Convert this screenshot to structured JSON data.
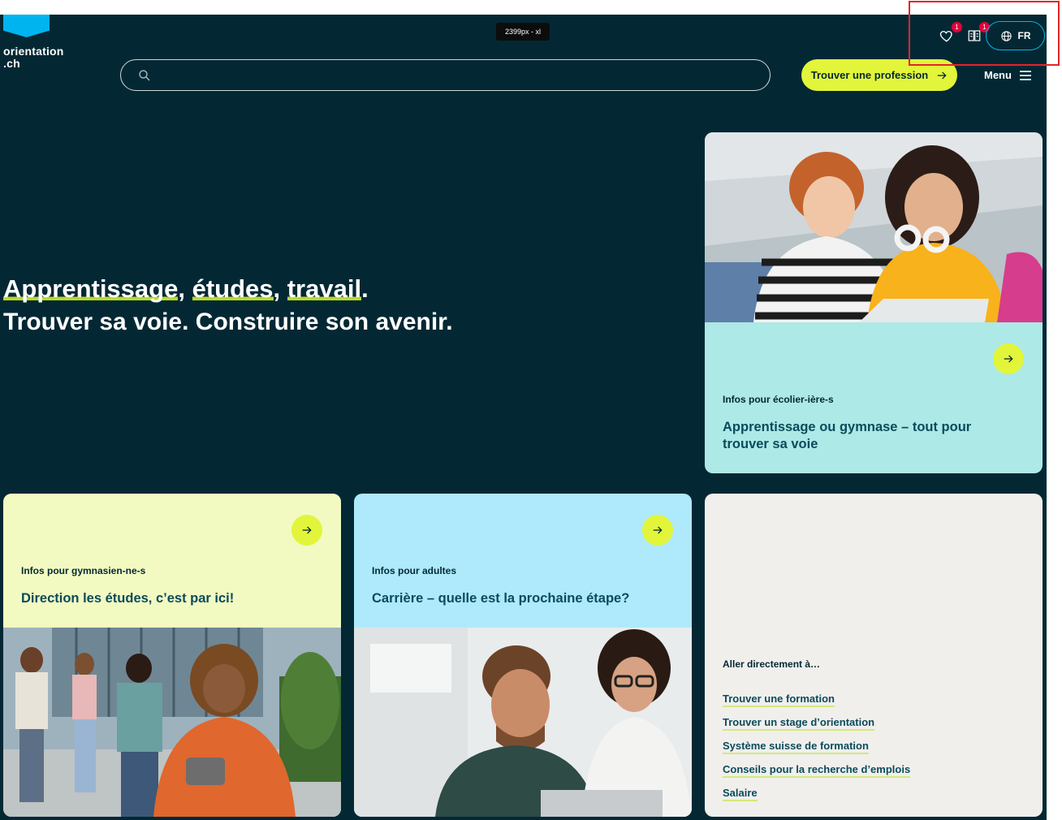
{
  "logo": {
    "line1": "orientation",
    "line2": ".ch"
  },
  "breakpoint_badge": "2399px - xl",
  "header": {
    "favorites_count": "1",
    "compare_count": "1",
    "language": "FR",
    "search_placeholder": "",
    "cta_label": "Trouver une profession",
    "menu_label": "Menu"
  },
  "hero": {
    "word1": "Apprentissage",
    "word2": "études",
    "word3": "travail",
    "tagline": "Trouver sa voie. Construire son avenir."
  },
  "cards": {
    "ecoliers": {
      "kicker": "Infos pour écolier-ière-s",
      "title": "Apprentissage ou gymnase – tout pour trouver sa voie"
    },
    "gymnasiens": {
      "kicker": "Infos pour gymnasien-ne-s",
      "title": "Direction les études, c’est par ici!"
    },
    "adultes": {
      "kicker": "Infos pour adultes",
      "title": "Carrière – quelle est la prochaine étape?"
    }
  },
  "quicklinks": {
    "heading": "Aller directement à…",
    "items": [
      "Trouver une formation",
      "Trouver un stage d’orientation",
      "Système suisse de formation",
      "Conseils pour la recherche d’emplois",
      "Salaire"
    ]
  },
  "colors": {
    "page_bg": "#032834",
    "accent_lime": "#e2f53a",
    "accent_blue": "#00b4ef",
    "card_mint": "#ade9e6",
    "card_lime": "#f2fac2",
    "card_sky": "#aeeafb",
    "card_neutral": "#f0efec",
    "annotation_red": "#e3242b"
  }
}
